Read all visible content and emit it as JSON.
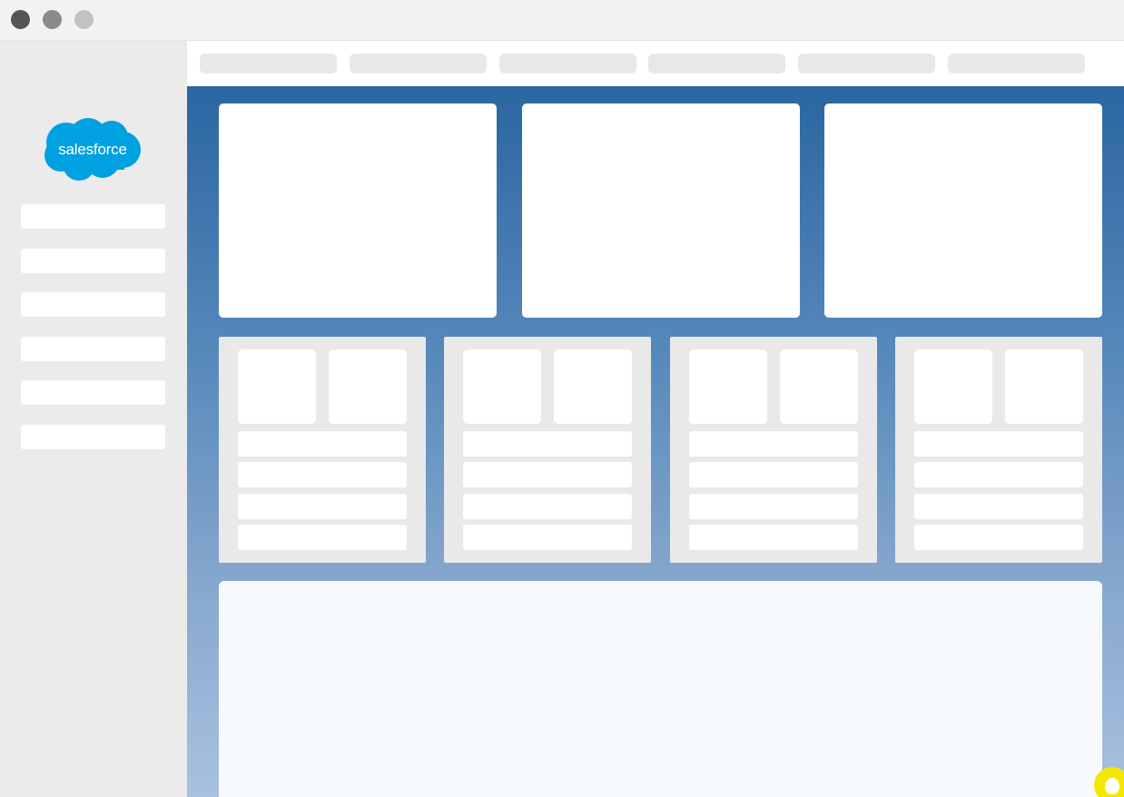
{
  "window": {
    "controls": {
      "close_color": "#555555",
      "minimize_color": "#8a8a8a",
      "maximize_color": "#c2c2c2"
    }
  },
  "sidebar": {
    "logo": {
      "text": "salesforce",
      "color": "#00a1e0",
      "icon": "salesforce-cloud-logo"
    }
  },
  "colors": {
    "accent": "#2a66a1",
    "placeholder": "#e8e8e8",
    "widget": "#f5e800"
  },
  "widget": {
    "icon": "chat-widget-icon"
  }
}
